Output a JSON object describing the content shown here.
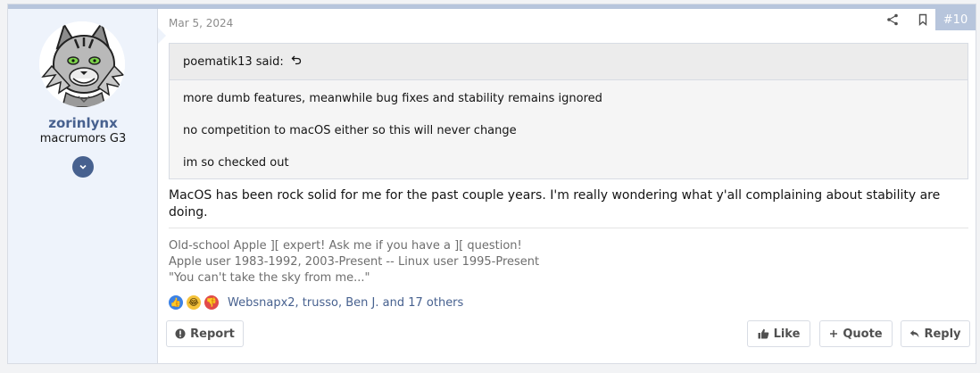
{
  "post": {
    "date": "Mar 5, 2024",
    "number": "#10",
    "message": "MacOS has been rock solid for me for the past couple years. I'm really wondering what y'all complaining about stability are doing."
  },
  "author": {
    "username": "zorinlynx",
    "title": "macrumors G3",
    "avatar_icon": "lynx-avatar-icon"
  },
  "quote": {
    "author_said": "poematik13 said:",
    "jump_icon": "jump-to-quote-icon",
    "lines": [
      "more dumb features, meanwhile bug fixes and stability remains ignored",
      "no competition to macOS either so this will never change",
      "im so checked out"
    ]
  },
  "signature": {
    "lines": [
      "Old-school Apple ][ expert! Ask me if you have a ][ question!",
      "Apple user 1983-1992, 2003-Present -- Linux user 1995-Present",
      "\"You can't take the sky from me...\""
    ]
  },
  "reactions": {
    "icons": [
      "like-reaction-icon",
      "haha-reaction-icon",
      "dislike-reaction-icon"
    ],
    "users_text": "Websnapx2, trusso, Ben J. and 17 others"
  },
  "actions": {
    "report": "Report",
    "like": "Like",
    "quote": "Quote",
    "reply": "Reply"
  },
  "colors": {
    "accent": "#47618f",
    "sidebar_bg": "#eef3fb",
    "post_number_bg": "#b7c5dc"
  }
}
